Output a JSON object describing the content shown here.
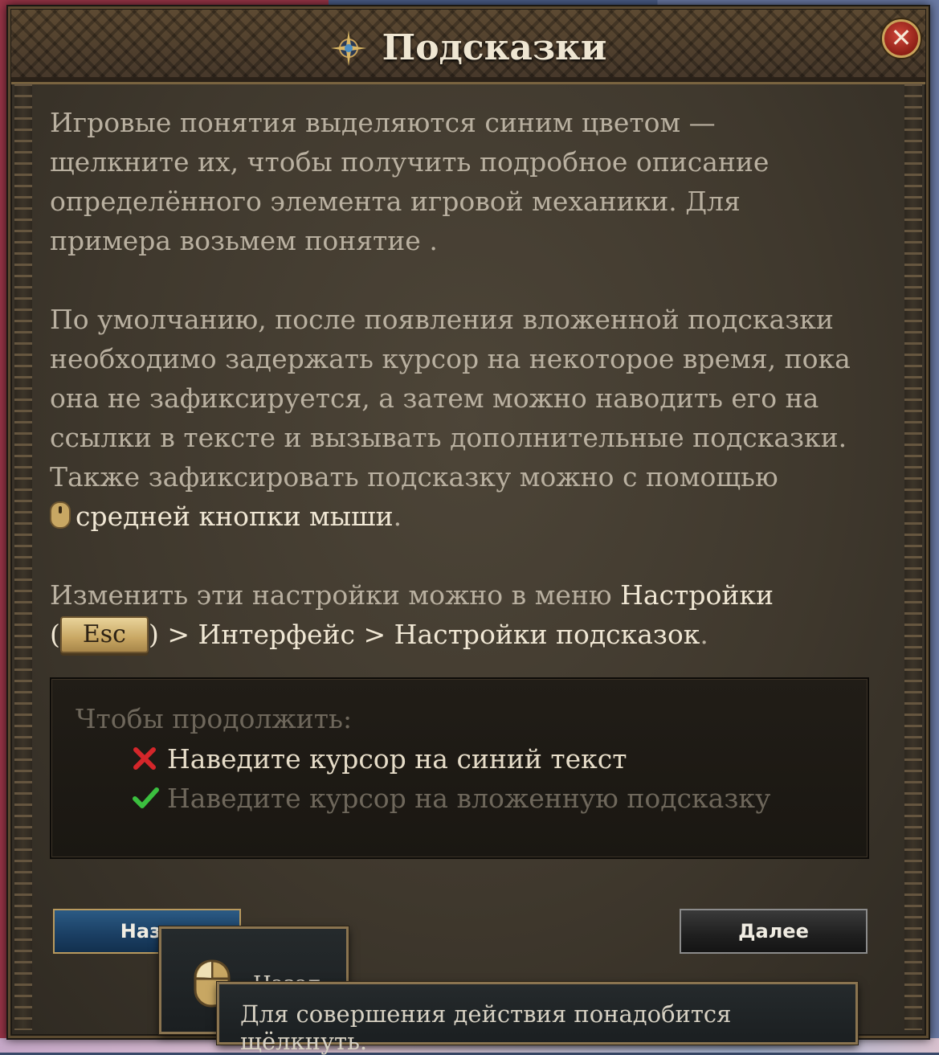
{
  "window": {
    "title": "Подсказки",
    "title_icon": "compass-star-icon",
    "close_icon": "close-icon"
  },
  "content": {
    "p1": "Игровые понятия выделяются синим цветом — щелкните их, чтобы получить подробное описание определённого элемента игровой механики. Для примера возьмем понятие .",
    "p2_main": "По умолчанию, после появления вложенной подсказки необходимо задержать курсор на некоторое время, пока она не зафиксируется, а затем можно наводить его на ссылки в тексте и вызывать дополнительные подсказки. Также зафиксировать подсказку можно с помощью ",
    "p2_highlight": "средней кнопки мыши",
    "p2_end": ".",
    "p3_start": "Изменить эти настройки можно в меню ",
    "p3_settings": "Настройки",
    "p3_paren_open": "(",
    "p3_esc_key": "Esc",
    "p3_paren_close": ")",
    "p3_sep1": " > ",
    "p3_interface": "Интерфейс",
    "p3_sep2": " > ",
    "p3_tooltip_settings": "Настройки подсказок",
    "p3_end": "."
  },
  "tasks": {
    "title": "Чтобы продолжить:",
    "items": [
      {
        "label": "Наведите курсор на синий текст",
        "status": "incomplete",
        "icon": "red-cross-icon"
      },
      {
        "label": "Наведите курсор на вложенную подсказку",
        "status": "complete",
        "icon": "green-check-icon"
      }
    ]
  },
  "buttons": {
    "back": "Наза",
    "next": "Далее"
  },
  "tooltips": {
    "small": "Назад",
    "large": "Для совершения действия понадобится щёлкнуть."
  },
  "colors": {
    "highlight_text": "#f0e7d4",
    "body_text": "#b9b0a0",
    "back_button": "#1a3e62",
    "next_button": "#1f1f1f",
    "frame_gold": "#b99a5e"
  }
}
